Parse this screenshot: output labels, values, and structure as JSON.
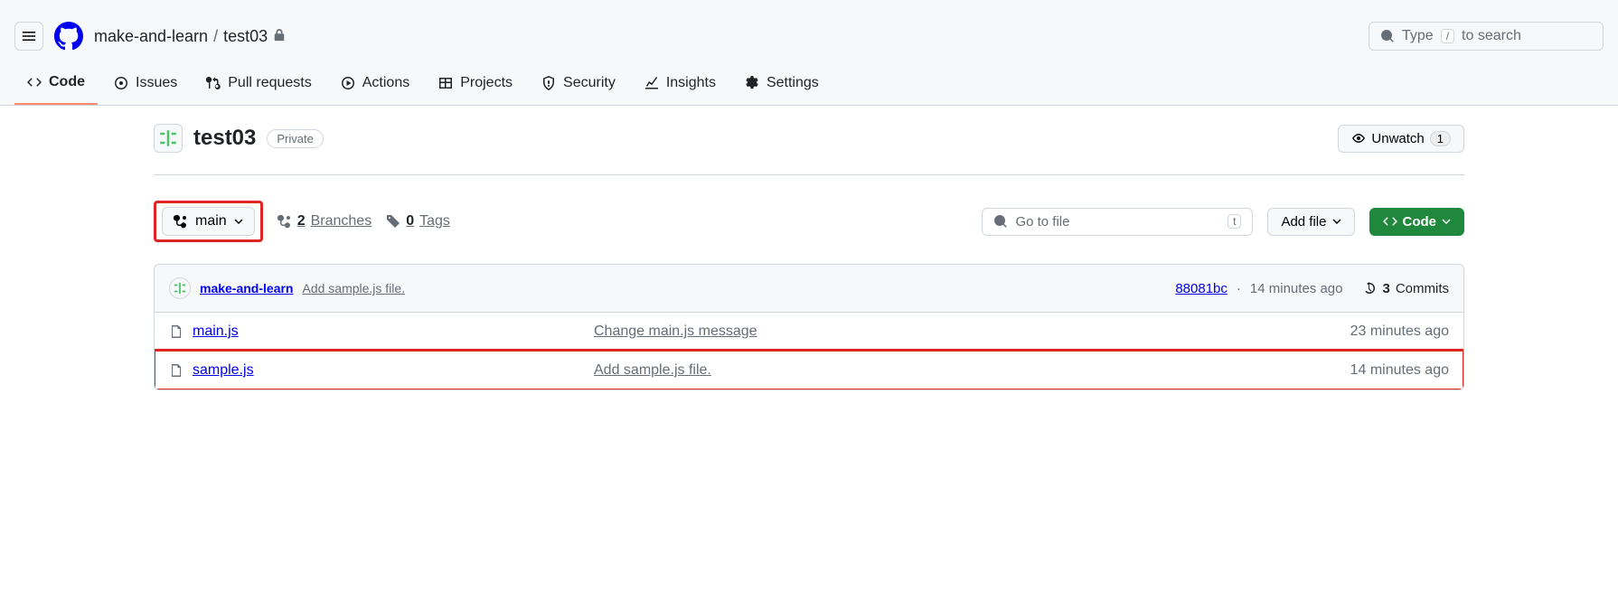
{
  "header": {
    "owner": "make-and-learn",
    "repo": "test03",
    "search": {
      "prefix": "Type",
      "kbd": "/",
      "suffix": "to search"
    }
  },
  "tabs": [
    {
      "label": "Code"
    },
    {
      "label": "Issues"
    },
    {
      "label": "Pull requests"
    },
    {
      "label": "Actions"
    },
    {
      "label": "Projects"
    },
    {
      "label": "Security"
    },
    {
      "label": "Insights"
    },
    {
      "label": "Settings"
    }
  ],
  "repo": {
    "name": "test03",
    "visibility": "Private",
    "unwatch_label": "Unwatch",
    "unwatch_count": "1"
  },
  "toolbar": {
    "branch": "main",
    "branches_count": "2",
    "branches_label": "Branches",
    "tags_count": "0",
    "tags_label": "Tags",
    "file_search_placeholder": "Go to file",
    "file_search_kbd": "t",
    "add_file_label": "Add file",
    "code_label": "Code"
  },
  "commit_header": {
    "author": "make-and-learn",
    "message": "Add sample.js file.",
    "sha": "88081bc",
    "time": "14 minutes ago",
    "commits_count": "3",
    "commits_label": "Commits"
  },
  "files": [
    {
      "name": "main.js",
      "message": "Change main.js message",
      "time": "23 minutes ago"
    },
    {
      "name": "sample.js",
      "message": "Add sample.js file.",
      "time": "14 minutes ago"
    }
  ]
}
